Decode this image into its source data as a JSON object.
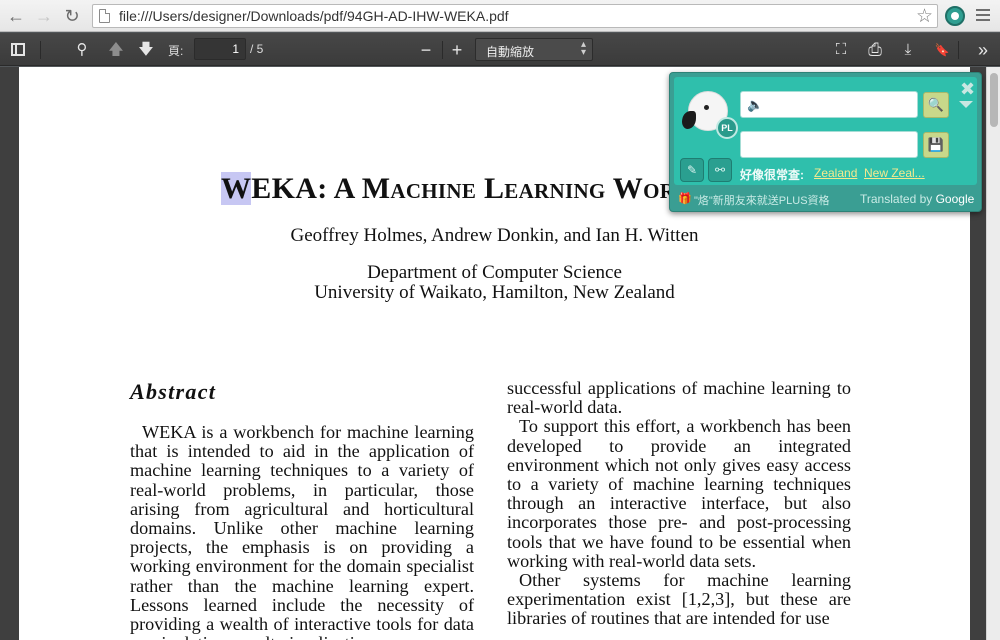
{
  "browser": {
    "back_icon": "←",
    "forward_icon": "→",
    "reload_icon": "↻",
    "url": "file:///Users/designer/Downloads/pdf/94GH-AD-IHW-WEKA.pdf",
    "star_icon": "☆"
  },
  "pdf_toolbar": {
    "page_label": "頁:",
    "page_current": "1",
    "page_total": "/ 5",
    "zoom_value": "自動縮放",
    "zoom_out_icon": "−",
    "zoom_in_icon": "+",
    "find_icon": "⚲",
    "prev_icon": "🡅",
    "next_icon": "🡇",
    "presentation_icon": "⛶",
    "print_icon": "⎙",
    "download_icon": "⤓",
    "bookmark_icon": "🔖",
    "more_icon": "»"
  },
  "document": {
    "title_w": "W",
    "title_rest": "EKA: A Machine Learning Workbench",
    "authors": "Geoffrey Holmes, Andrew Donkin, and Ian H. Witten",
    "dept_line1": "Department of Computer Science",
    "dept_line2": "University of Waikato, Hamilton, New Zealand",
    "abstract_heading": "Abstract",
    "left_column": "WEKA is a workbench for machine learning that is intended to aid in the application of machine learning techniques to a variety of real-world problems, in particular, those arising from agricultural and horticultural domains. Unlike other machine learning projects, the emphasis is on providing a working environment for the domain specialist rather than the machine learning expert. Lessons learned include the necessity of providing a wealth of interactive tools for data manipulation, result visualization,",
    "right_column_p1": "successful applications of machine learning to real-world data.",
    "right_column_p2": "To support this effort, a workbench has been developed to provide an integrated environment which not only gives easy access to a variety of machine learning techniques through an interactive interface, but also incorporates those pre- and post-processing tools that we have found to be essential when working with real-world data sets.",
    "right_column_p3": "Other systems for machine learning experimentation exist [1,2,3], but these are libraries of routines that are intended for use"
  },
  "translator": {
    "badge": "PL",
    "source_placeholder": "",
    "target_placeholder": "",
    "speaker_icon": "🔈",
    "search_icon": "🔍",
    "save_icon": "💾",
    "close_icon": "✖",
    "edit_icon": "✎",
    "unlink_icon": "⚯",
    "suggest_label": "好像很常查:",
    "suggestions": [
      "Zealand",
      "New Zeal..."
    ],
    "gift_icon": "🎁",
    "promo_text": "\"烙\"新朋友來就送PLUS資格",
    "credit_prefix": "Translated by ",
    "credit_brand": "Google"
  }
}
